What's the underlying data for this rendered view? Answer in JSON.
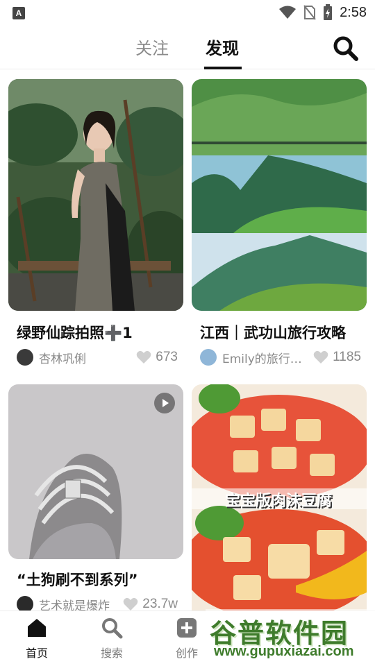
{
  "status_bar": {
    "time": "2:58"
  },
  "tabs": {
    "follow": "关注",
    "discover": "发现"
  },
  "feed": {
    "cards": [
      {
        "title": "绿野仙踪拍照➕1",
        "author": "杏林巩俐",
        "likes": "673"
      },
      {
        "title": "江西｜武功山旅行攻略",
        "author": "Emily的旅行…",
        "likes": "1185"
      },
      {
        "title": "“土狗刷不到系列”",
        "author": "艺术就是爆炸",
        "likes": "23.7w"
      },
      {
        "title": "",
        "author": "",
        "likes": "",
        "image_caption": "宝宝版肉沫豆腐"
      }
    ]
  },
  "bottom_nav": {
    "home": "首页",
    "search": "搜索",
    "create": "创作"
  },
  "watermark": {
    "title": "谷普软件园",
    "url": "www.gupuxiazai.com"
  },
  "colors": {
    "accent_dark": "#111111",
    "muted": "#8a8a8a",
    "watermark_green": "#3f7c2c"
  }
}
